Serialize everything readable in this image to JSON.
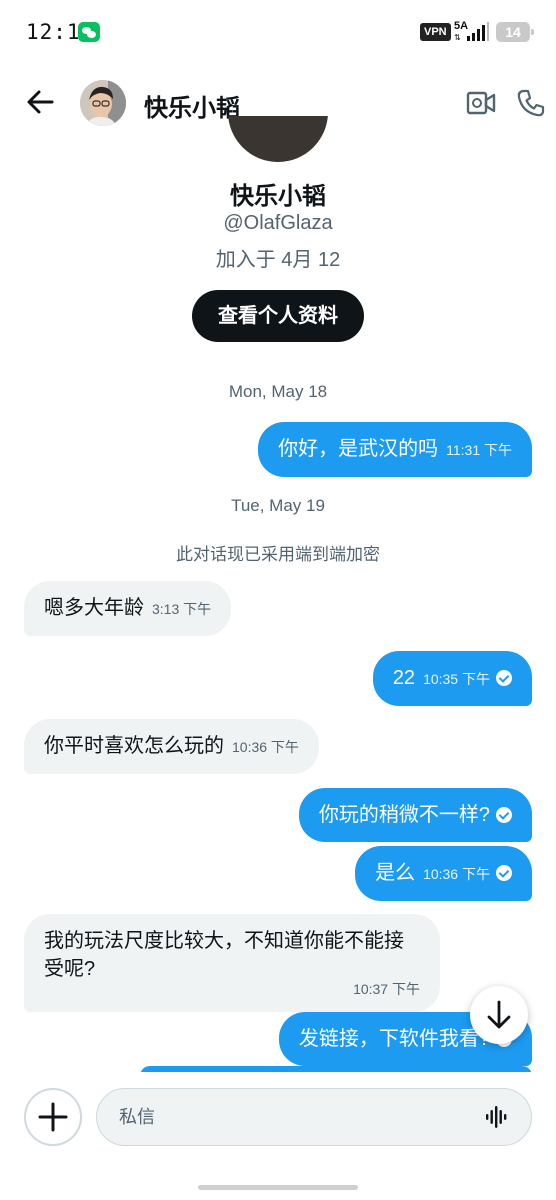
{
  "status_bar": {
    "time": "12:13",
    "vpn": "VPN",
    "network": "5A",
    "battery": "14",
    "app_icon": "wechat-icon"
  },
  "header": {
    "name": "快乐小韬",
    "back_icon": "arrow-left-icon",
    "video_icon": "video-call-icon",
    "phone_icon": "phone-call-icon"
  },
  "profile": {
    "name": "快乐小韬",
    "handle": "@OlafGlaza",
    "joined": "加入于 4月 12",
    "view_profile_label": "查看个人资料"
  },
  "conversation": {
    "date_1": "Mon, May 18",
    "date_2": "Tue, May 19",
    "encryption_note": "此对话现已采用端到端加密",
    "messages": [
      {
        "direction": "out",
        "text": "你好，是武汉的吗",
        "time": "11:31 下午",
        "read": false
      },
      {
        "direction": "in",
        "text": "嗯多大年龄",
        "time": "3:13 下午"
      },
      {
        "direction": "out",
        "text": "22",
        "time": "10:35 下午",
        "read": true
      },
      {
        "direction": "in",
        "text": "你平时喜欢怎么玩的",
        "time": "10:36 下午"
      },
      {
        "direction": "out",
        "text": "你玩的稍微不一样?",
        "time": "",
        "read": true
      },
      {
        "direction": "out",
        "text": "是么",
        "time": "10:36 下午",
        "read": true
      },
      {
        "direction": "in",
        "text": "我的玩法尺度比较大，不知道你能不能接受呢?",
        "time": "10:37 下午"
      },
      {
        "direction": "out",
        "text": "发链接，下软件我看?",
        "time": "",
        "read": true
      }
    ]
  },
  "composer": {
    "placeholder": "私信",
    "add_icon": "plus-icon",
    "voice_icon": "voice-wave-icon"
  },
  "colors": {
    "accent": "#1d9bf0",
    "incoming_bubble": "#eff3f4",
    "text_primary": "#0f1419",
    "text_secondary": "#536471"
  }
}
